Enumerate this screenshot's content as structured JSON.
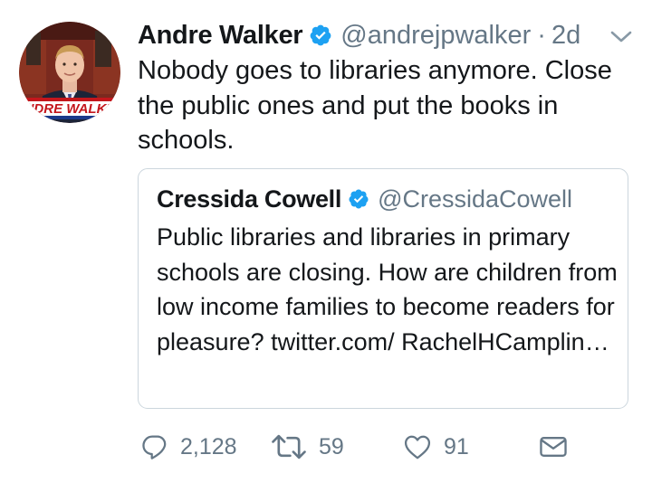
{
  "tweet": {
    "author": {
      "display_name": "Andre Walker",
      "handle": "@andrejpwalker",
      "verified": true
    },
    "separator": "·",
    "time": "2d",
    "text": "Nobody goes to libraries anymore. Close the public ones and put the books in schools.",
    "quoted": {
      "display_name": "Cressida Cowell",
      "handle": "@CressidaCowell",
      "verified": true,
      "text": "Public libraries and libraries in primary schools are closing. How are children from low income families to become readers for pleasure? twitter.com/ RachelHCamplin…"
    },
    "actions": {
      "replies": "2,128",
      "retweets": "59",
      "likes": "91"
    }
  },
  "icons": {
    "verified": "verified-badge-icon",
    "more": "chevron-down-icon",
    "reply": "reply-icon",
    "retweet": "retweet-icon",
    "like": "heart-icon",
    "dm": "envelope-icon"
  },
  "colors": {
    "text": "#14171a",
    "secondary": "#657786",
    "verified": "#1da1f2",
    "border": "#ccd6dd"
  }
}
